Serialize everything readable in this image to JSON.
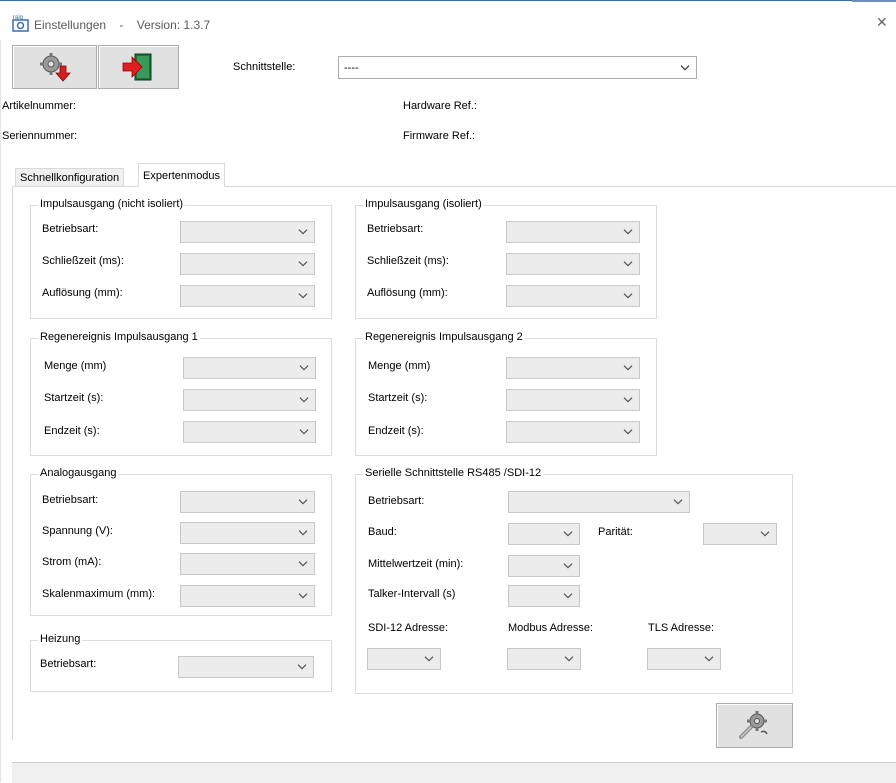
{
  "window": {
    "app_name": "Einstellungen",
    "separator": "-",
    "version_label": "Version: 1.3.7"
  },
  "toolbar": {
    "save_icon": "gear-download-icon",
    "exit_icon": "exit-door-icon"
  },
  "connection": {
    "interface_label": "Schnittstelle:",
    "interface_value": "----"
  },
  "device_info": {
    "article_number_label": "Artikelnummer:",
    "serial_number_label": "Seriennummer:",
    "hardware_ref_label": "Hardware Ref.:",
    "firmware_ref_label": "Firmware Ref.:"
  },
  "tabs": [
    {
      "label": "Schnellkonfiguration",
      "active": false
    },
    {
      "label": "Expertenmodus",
      "active": true
    }
  ],
  "groups": {
    "pulse_non_isolated": {
      "title": "Impulsausgang (nicht isoliert)",
      "fields": [
        "Betriebsart:",
        "Schließzeit (ms):",
        "Auflösung (mm):"
      ]
    },
    "pulse_isolated": {
      "title": "Impulsausgang (isoliert)",
      "fields": [
        "Betriebsart:",
        "Schließzeit (ms):",
        "Auflösung (mm):"
      ]
    },
    "rain_event_1": {
      "title": "Regenereignis Impulsausgang 1",
      "fields": [
        "Menge (mm)",
        "Startzeit (s):",
        "Endzeit (s):"
      ]
    },
    "rain_event_2": {
      "title": "Regenereignis Impulsausgang 2",
      "fields": [
        "Menge (mm)",
        "Startzeit (s):",
        "Endzeit (s):"
      ]
    },
    "analog": {
      "title": "Analogausgang",
      "fields": [
        "Betriebsart:",
        "Spannung (V):",
        "Strom (mA):",
        "Skalenmaximum (mm):"
      ]
    },
    "heating": {
      "title": "Heizung",
      "fields": [
        "Betriebsart:"
      ]
    },
    "serial": {
      "title": "Serielle Schnittstelle RS485 /SDI-12",
      "mode_label": "Betriebsart:",
      "baud_label": "Baud:",
      "parity_label": "Parität:",
      "averaging_label": "Mittelwertzeit (min):",
      "talker_label": "Talker-Intervall (s)",
      "sdi_address_label": "SDI-12 Adresse:",
      "modbus_address_label": "Modbus  Adresse:",
      "tls_address_label": "TLS  Adresse:"
    }
  },
  "actions": {
    "apply_icon": "wrench-gear-icon"
  }
}
